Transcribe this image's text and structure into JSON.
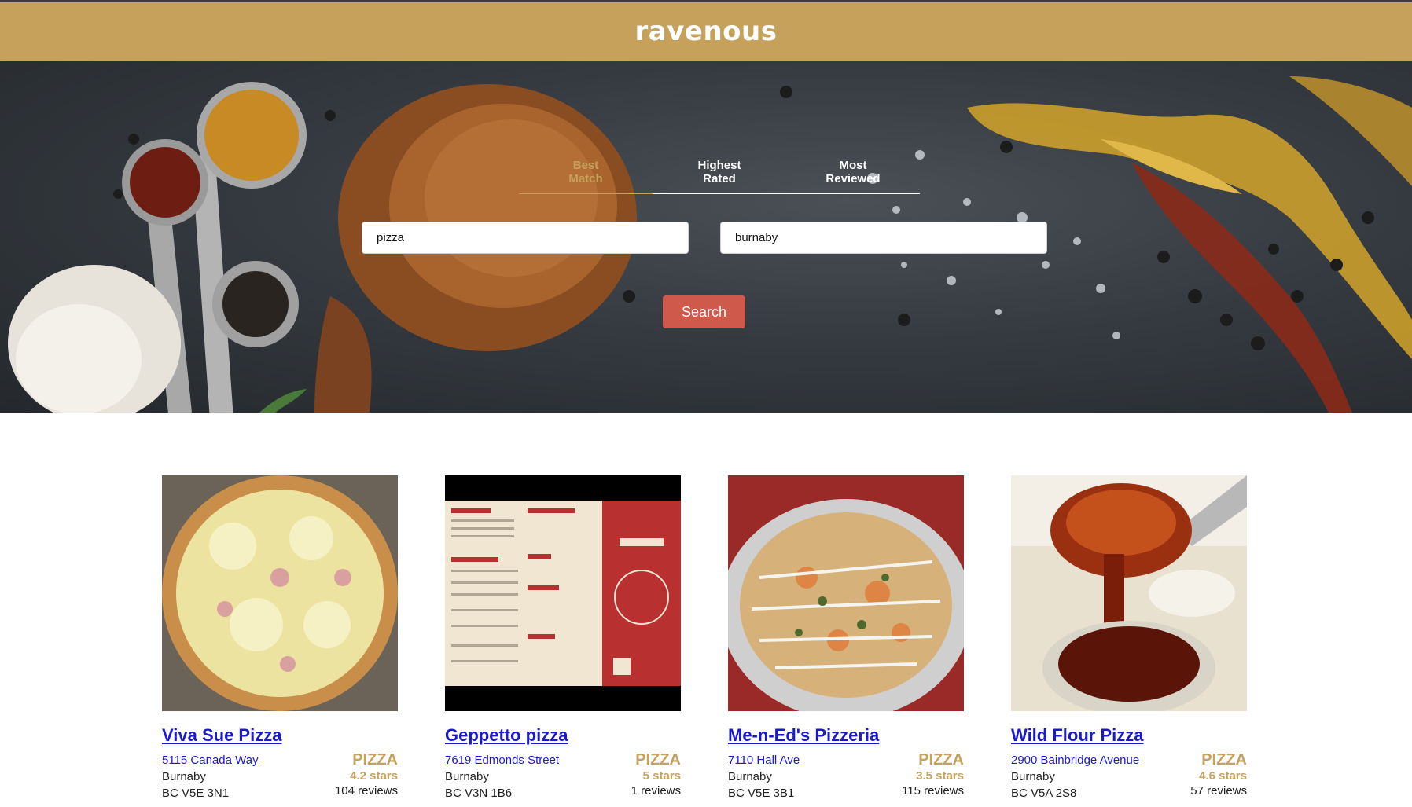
{
  "header": {
    "brand": "ravenous"
  },
  "sort_tabs": [
    {
      "label": "Best Match",
      "active": true
    },
    {
      "label": "Highest Rated",
      "active": false
    },
    {
      "label": "Most Reviewed",
      "active": false
    }
  ],
  "search": {
    "term_value": "pizza",
    "location_value": "burnaby",
    "button_label": "Search"
  },
  "colors": {
    "accent": "#c6a15b",
    "button": "#cf5a4c",
    "link": "#1a1acc"
  },
  "businesses": [
    {
      "name": "Viva Sue Pizza",
      "address": "5115 Canada Way",
      "city": "Burnaby",
      "state_zip": "BC V5E 3N1",
      "category": "PIZZA",
      "rating": "4.2 stars",
      "reviews": "104 reviews",
      "image": "cheese-pizza-photo"
    },
    {
      "name": "Geppetto pizza",
      "address": "7619 Edmonds Street",
      "city": "Burnaby",
      "state_zip": "BC V3N 1B6",
      "category": "PIZZA",
      "rating": "5 stars",
      "reviews": "1 reviews",
      "image": "menu-flyer-photo"
    },
    {
      "name": "Me-n-Ed's Pizzeria",
      "address": "7110 Hall Ave",
      "city": "Burnaby",
      "state_zip": "BC V5E 3B1",
      "category": "PIZZA",
      "rating": "3.5 stars",
      "reviews": "115 reviews",
      "image": "veggie-pizza-photo"
    },
    {
      "name": "Wild Flour Pizza",
      "address": "2900 Bainbridge Avenue",
      "city": "Burnaby",
      "state_zip": "BC V5A 2S8",
      "category": "PIZZA",
      "rating": "4.6 stars",
      "reviews": "57 reviews",
      "image": "chili-oil-photo"
    }
  ]
}
